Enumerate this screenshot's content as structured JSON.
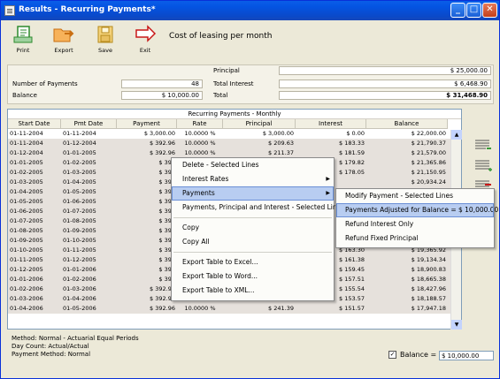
{
  "window": {
    "title": "Results - Recurring Payments*"
  },
  "toolbar": {
    "print": "Print",
    "export": "Export",
    "save": "Save",
    "exit": "Exit",
    "caption": "Cost of leasing per month"
  },
  "summary": {
    "principal_label": "Principal",
    "principal_value": "$ 25,000.00",
    "num_payments_label": "Number of Payments",
    "num_payments_value": "48",
    "total_interest_label": "Total Interest",
    "total_interest_value": "$ 6,468.90",
    "balance_label": "Balance",
    "balance_value": "$ 10,000.00",
    "total_label": "Total",
    "total_value": "$ 31,468.90"
  },
  "grid": {
    "title": "Recurring Payments - Monthly",
    "columns": [
      "Start Date",
      "Pmt Date",
      "Payment",
      "Rate",
      "Principal",
      "Interest",
      "Balance"
    ],
    "rows": [
      [
        "01-11-2004",
        "01-11-2004",
        "$ 3,000.00",
        "10.0000 %",
        "$ 3,000.00",
        "$ 0.00",
        "$ 22,000.00"
      ],
      [
        "01-11-2004",
        "01-12-2004",
        "$ 392.96",
        "10.0000 %",
        "$ 209.63",
        "$ 183.33",
        "$ 21,790.37"
      ],
      [
        "01-12-2004",
        "01-01-2005",
        "$ 392.96",
        "10.0000 %",
        "$ 211.37",
        "$ 181.59",
        "$ 21,579.00"
      ],
      [
        "01-01-2005",
        "01-02-2005",
        "$ 392",
        "",
        "",
        "$ 179.82",
        "$ 21,365.86"
      ],
      [
        "01-02-2005",
        "01-03-2005",
        "$ 392",
        "",
        "",
        "$ 178.05",
        "$ 21,150.95"
      ],
      [
        "01-03-2005",
        "01-04-2005",
        "$ 392",
        "",
        "",
        "",
        "$ 20,934.24"
      ],
      [
        "01-04-2005",
        "01-05-2005",
        "$ 392",
        "",
        "",
        "",
        ""
      ],
      [
        "01-05-2005",
        "01-06-2005",
        "$ 392",
        "",
        "",
        "",
        ""
      ],
      [
        "01-06-2005",
        "01-07-2005",
        "$ 392",
        "",
        "",
        "",
        ""
      ],
      [
        "01-07-2005",
        "01-08-2005",
        "$ 392",
        "",
        "",
        "",
        ""
      ],
      [
        "01-08-2005",
        "01-09-2005",
        "$ 392",
        "",
        "",
        "",
        ""
      ],
      [
        "01-09-2005",
        "01-10-2005",
        "$ 392",
        "",
        "",
        "$ 165.19",
        "$ 19,595.58"
      ],
      [
        "01-10-2005",
        "01-11-2005",
        "$ 392",
        "",
        "",
        "$ 163.30",
        "$ 19,365.92"
      ],
      [
        "01-11-2005",
        "01-12-2005",
        "$ 392",
        "",
        "",
        "$ 161.38",
        "$ 19,134.34"
      ],
      [
        "01-12-2005",
        "01-01-2006",
        "$ 392",
        "",
        "",
        "$ 159.45",
        "$ 18,900.83"
      ],
      [
        "01-01-2006",
        "01-02-2006",
        "$ 392",
        "",
        "",
        "$ 157.51",
        "$ 18,665.38"
      ],
      [
        "01-02-2006",
        "01-03-2006",
        "$ 392.96",
        "10.0000 %",
        "$ 237.42",
        "$ 155.54",
        "$ 18,427.96"
      ],
      [
        "01-03-2006",
        "01-04-2006",
        "$ 392.96",
        "10.0000 %",
        "$ 239.39",
        "$ 153.57",
        "$ 18,188.57"
      ],
      [
        "01-04-2006",
        "01-05-2006",
        "$ 392.96",
        "10.0000 %",
        "$ 241.39",
        "$ 151.57",
        "$ 17,947.18"
      ]
    ]
  },
  "footer": {
    "method": "Method: Normal - Actuarial Equal Periods",
    "day_count": "Day Count: Actual/Actual",
    "payment_method": "Payment Method: Normal"
  },
  "balance_toggle": {
    "label": "Balance =",
    "value": "$ 10,000.00",
    "checked": true
  },
  "context_menu": {
    "items": [
      "Delete - Selected Lines",
      "Interest Rates",
      "Payments",
      "Payments, Principal and Interest - Selected Lines",
      "Copy",
      "Copy All",
      "Export Table to Excel...",
      "Export Table to Word...",
      "Export Table to XML..."
    ]
  },
  "submenu": {
    "items": [
      "Modify Payment - Selected Lines",
      "Payments Adjusted for Balance = $ 10,000.00",
      "Refund Interest Only",
      "Refund Fixed Principal"
    ]
  },
  "colors": {
    "title_bar": "#0a5ee8",
    "window_bg": "#ece9d8",
    "row_alt": "#e6e1dc",
    "menu_highlight": "#b8cdf1"
  }
}
